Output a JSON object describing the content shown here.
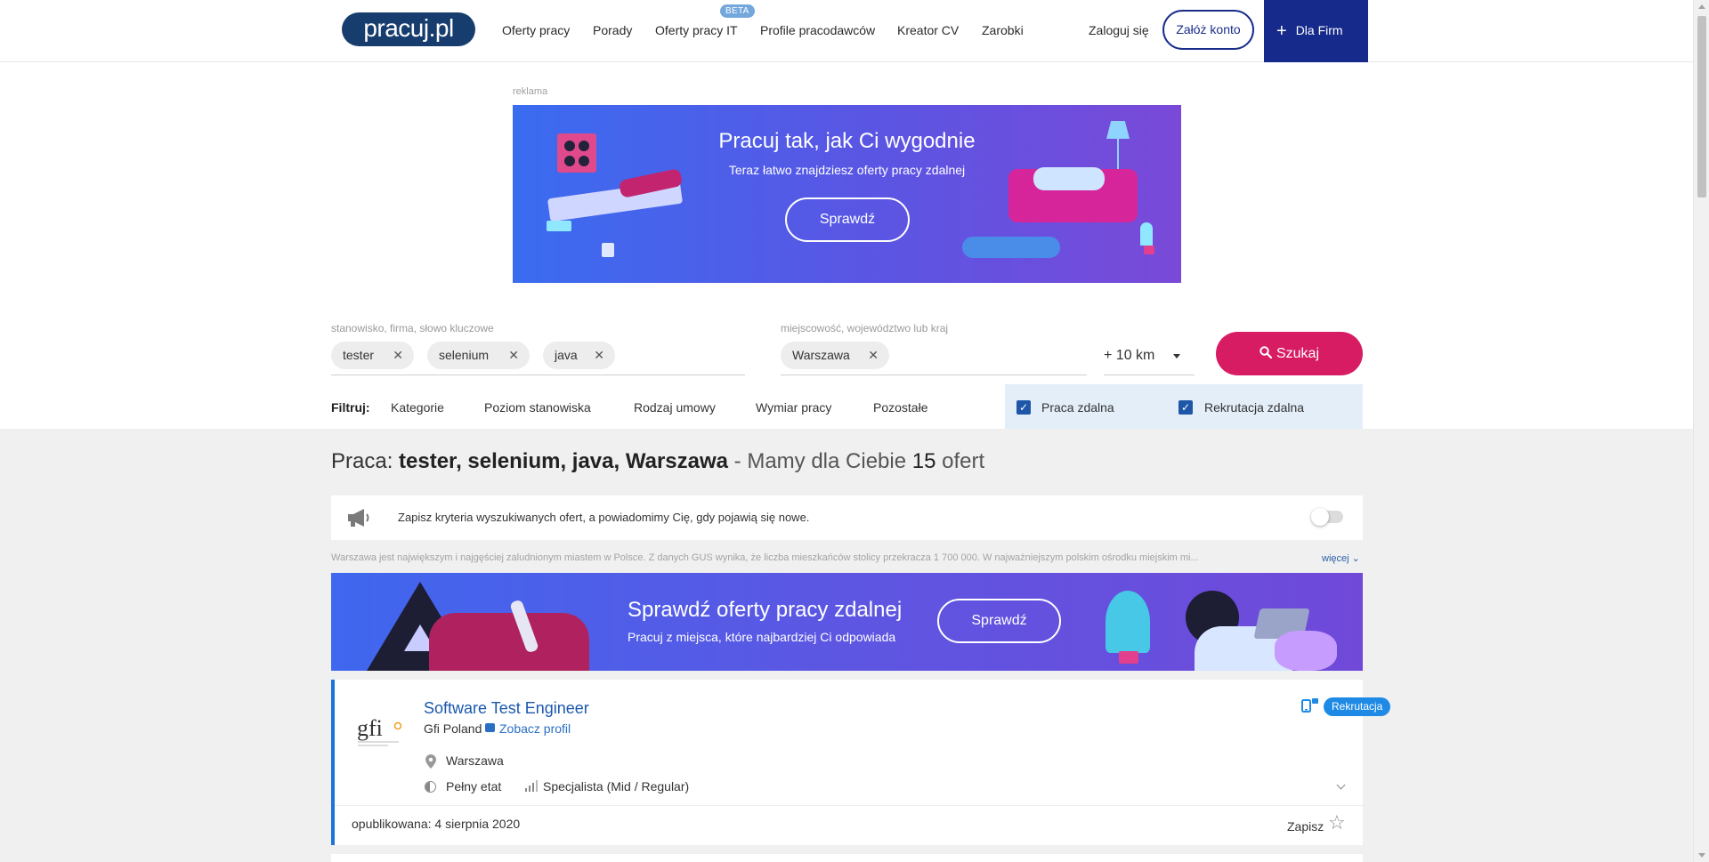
{
  "header": {
    "logo": "pracuj.pl",
    "nav": [
      "Oferty pracy",
      "Porady",
      "Oferty pracy IT",
      "Profile pracodawców",
      "Kreator CV",
      "Zarobki"
    ],
    "beta_badge": "BETA",
    "login": "Zaloguj się",
    "register": "Załóż konto",
    "for_firms": "Dla Firm"
  },
  "ad": {
    "label": "reklama",
    "title": "Pracuj tak, jak Ci wygodnie",
    "subtitle": "Teraz łatwo znajdziesz oferty pracy zdalnej",
    "button": "Sprawdź"
  },
  "search": {
    "keywords_label": "stanowisko, firma, słowo kluczowe",
    "keywords": [
      "tester",
      "selenium",
      "java"
    ],
    "location_label": "miejscowość, województwo lub kraj",
    "location": "Warszawa",
    "radius": "+ 10 km",
    "search_button": "Szukaj"
  },
  "filters": {
    "label": "Filtruj:",
    "items": [
      "Kategorie",
      "Poziom stanowiska",
      "Rodzaj umowy",
      "Wymiar pracy",
      "Pozostałe"
    ],
    "checks": [
      {
        "label": "Praca zdalna",
        "checked": true
      },
      {
        "label": "Rekrutacja zdalna",
        "checked": true
      }
    ]
  },
  "results": {
    "prefix": "Praca: ",
    "query": "tester, selenium, java, Warszawa",
    "sep": " - ",
    "count_prefix": "Mamy dla Ciebie ",
    "count": "15",
    "count_suffix": " ofert"
  },
  "alert": {
    "text": "Zapisz kryteria wyszukiwanych ofert, a powiadomimy Cię, gdy pojawią się nowe.",
    "enabled": false
  },
  "city_description": "Warszawa jest największym i najgęściej zaludnionym miastem w Polsce. Z danych GUS wynika, że liczba mieszkańców stolicy przekracza 1 700 000. W najważniejszym polskim ośrodku miejskim mi...",
  "more_link": "więcej",
  "banner2": {
    "title": "Sprawdź oferty pracy zdalnej",
    "subtitle": "Pracuj z miejsca, które najbardziej Ci odpowiada",
    "button": "Sprawdź"
  },
  "job": {
    "title": "Software Test Engineer",
    "company": "Gfi Poland",
    "profile_link": "Zobacz profil",
    "logo_text": "gfi",
    "location": "Warszawa",
    "employment": "Pełny etat",
    "level": "Specjalista (Mid / Regular)",
    "badge": "Rekrutacja zdalna",
    "published": "opublikowana: 4 sierpnia 2020",
    "save": "Zapisz"
  },
  "colors": {
    "brand_navy": "#162a8c",
    "search_pink": "#d71c64",
    "link_blue": "#1b59ad",
    "badge_blue": "#1e8ae6",
    "card_accent": "#1e73d8"
  }
}
